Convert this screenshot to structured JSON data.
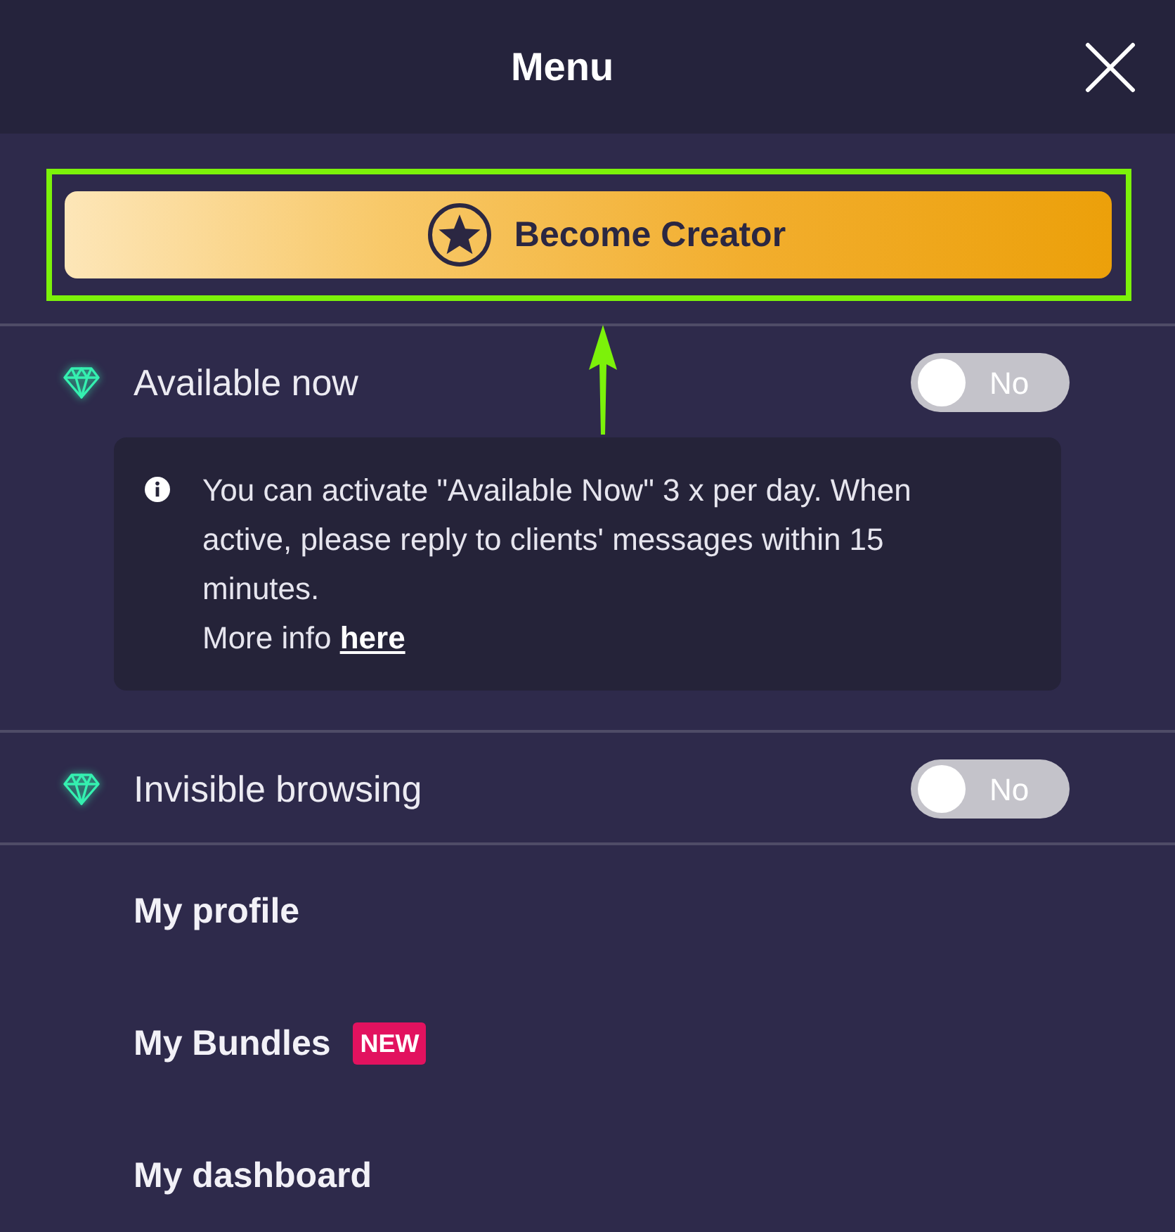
{
  "header": {
    "title": "Menu"
  },
  "creator_button": {
    "label": "Become Creator",
    "highlighted": true
  },
  "toggles": [
    {
      "label": "Available now",
      "on": false,
      "state_label": "No",
      "info": {
        "text": "You can activate \"Available Now\" 3 x per day. When active, please reply to clients' messages within 15 minutes.",
        "more_text": "More info",
        "link": "here"
      }
    },
    {
      "label": "Invisible browsing",
      "on": false,
      "state_label": "No"
    }
  ],
  "menu_items": [
    {
      "label": "My profile"
    },
    {
      "label": "My Bundles",
      "badge": "NEW"
    },
    {
      "label": "My dashboard"
    }
  ]
}
